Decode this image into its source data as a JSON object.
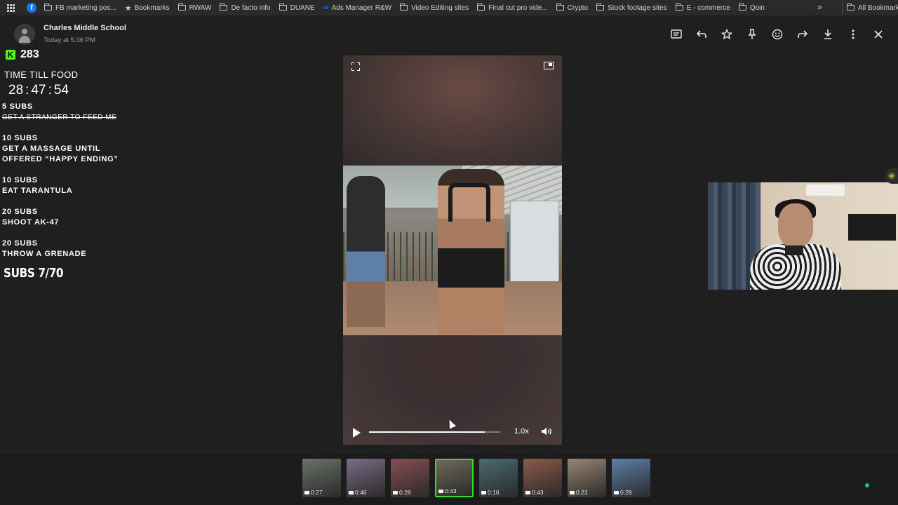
{
  "bookmarks": {
    "items": [
      {
        "label": "FB marketing pos...",
        "icon": "folder-icon"
      },
      {
        "label": "Bookmarks",
        "icon": "star-icon"
      },
      {
        "label": "RWAW",
        "icon": "folder-icon"
      },
      {
        "label": "De facto info",
        "icon": "folder-icon"
      },
      {
        "label": "DUANE",
        "icon": "folder-icon"
      },
      {
        "label": "Ads Manager R&W",
        "icon": "meta-icon"
      },
      {
        "label": "Video Editing sites",
        "icon": "folder-icon"
      },
      {
        "label": "Final cut pro vide...",
        "icon": "folder-icon"
      },
      {
        "label": "Crypto",
        "icon": "folder-icon"
      },
      {
        "label": "Stock footage sites",
        "icon": "folder-icon"
      },
      {
        "label": "E - commerce",
        "icon": "folder-icon"
      },
      {
        "label": "Qoin",
        "icon": "folder-icon"
      }
    ],
    "overflow": "»",
    "all": "All Bookmarks"
  },
  "header": {
    "sender": "Charles Middle School",
    "time": "Today at 5:36 PM"
  },
  "toolbar": [
    "message-icon",
    "reply-icon",
    "star-icon",
    "pin-icon",
    "emoji-icon",
    "forward-icon",
    "download-icon",
    "more-icon",
    "close-icon"
  ],
  "overlay": {
    "kick_count": "283",
    "kick_logo": "K",
    "time_till_food": "TIME TILL FOOD",
    "timer": {
      "h": "28",
      "m": "47",
      "s": "54"
    },
    "goals": [
      {
        "title": "5 SUBS",
        "desc": "GET A STRANGER TO FEED ME",
        "done": true
      },
      {
        "title": "10 SUBS",
        "desc": "GET A MASSAGE UNTIL",
        "desc2": "OFFERED “HAPPY ENDING”",
        "done": false
      },
      {
        "title": "10 SUBS",
        "desc": "EAT TARANTULA",
        "done": false
      },
      {
        "title": "20 SUBS",
        "desc": "SHOOT AK-47",
        "done": false
      },
      {
        "title": "20 SUBS",
        "desc": "THROW A GRENADE",
        "done": false
      }
    ],
    "subs_total": "SUBS 7/70"
  },
  "video": {
    "speed": "1.0x",
    "progress": 0.88
  },
  "thumbnails": [
    {
      "duration": "0:27",
      "bg": "#6b7268"
    },
    {
      "duration": "0:46",
      "bg": "#7a6c86"
    },
    {
      "duration": "0:28",
      "bg": "#8a4d52"
    },
    {
      "duration": "0:43",
      "bg": "#6d6a58",
      "active": true
    },
    {
      "duration": "0:16",
      "bg": "#4a6b72"
    },
    {
      "duration": "0:43",
      "bg": "#8c5a4a"
    },
    {
      "duration": "0:23",
      "bg": "#9a8572"
    },
    {
      "duration": "0:28",
      "bg": "#5e7fa8"
    }
  ]
}
